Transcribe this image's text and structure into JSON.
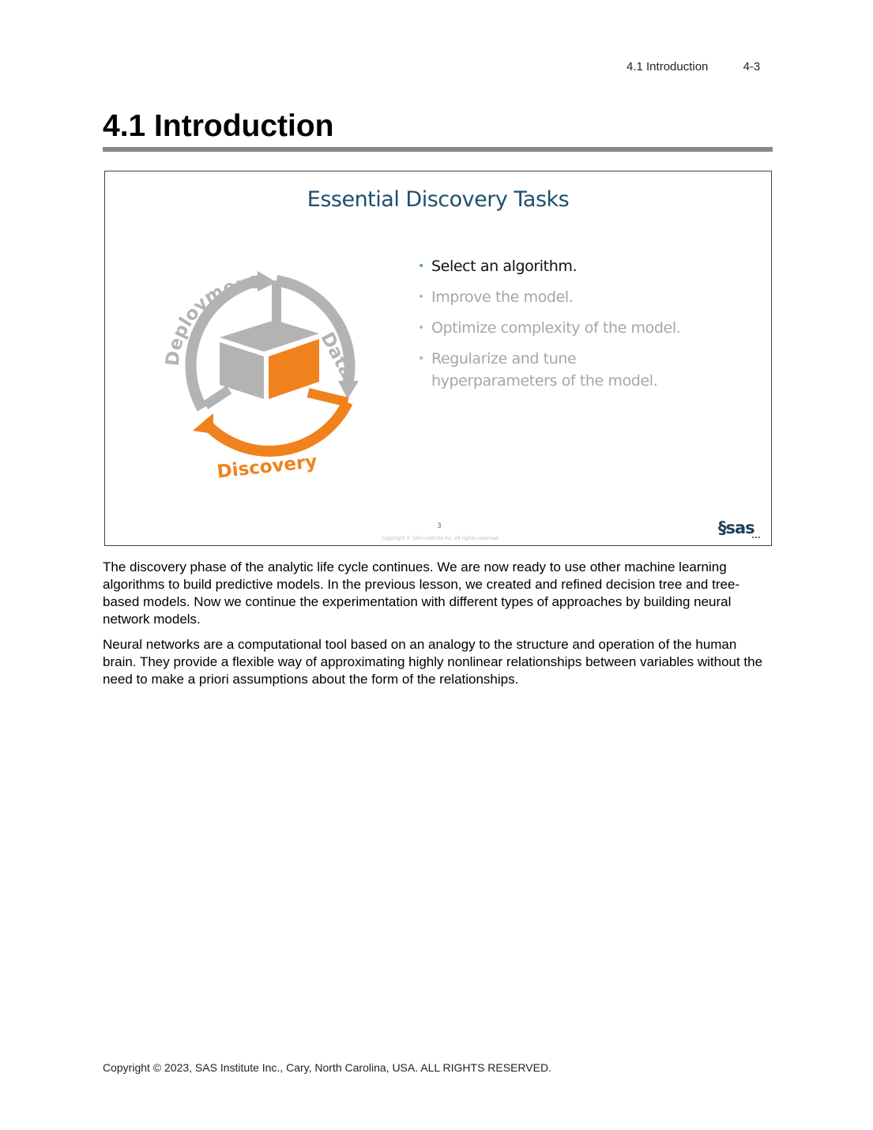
{
  "header": {
    "section": "4.1  Introduction",
    "page_number": "4-3"
  },
  "heading": "4.1 Introduction",
  "slide": {
    "title": "Essential Discovery Tasks",
    "cycle_labels": {
      "deployment": "Deployment",
      "data": "Data",
      "discovery": "Discovery"
    },
    "bullets": [
      {
        "text": "Select an algorithm.",
        "active": true
      },
      {
        "text": "Improve the model.",
        "active": false
      },
      {
        "text": "Optimize complexity of the model.",
        "active": false
      },
      {
        "text": "Regularize and tune hyperparameters of the model.",
        "active": false
      }
    ],
    "slide_number": "3",
    "copyright": "Copyright © SAS Institute Inc. All rights reserved.",
    "logo_text": "sas"
  },
  "colors": {
    "gray": "#b3b3b3",
    "orange": "#f0821e",
    "title_blue": "#1f4e6d",
    "bullet_blue": "#4a9fc9"
  },
  "body": {
    "paragraph_1": "The discovery phase of the analytic life cycle continues. We are now ready to use other machine learning algorithms to build predictive models. In the previous lesson, we created and refined decision tree and tree-based models. Now we continue the experimentation with different types of approaches by building neural network models.",
    "paragraph_2": "Neural networks are a computational tool based on an analogy to the structure and operation of the human brain. They provide a flexible way of approximating highly nonlinear relationships between variables without the need to make a priori assumptions about the form of the relationships."
  },
  "footer": {
    "copyright": "Copyright © 2023, SAS Institute Inc., Cary, North Carolina, USA. ALL RIGHTS RESERVED."
  }
}
